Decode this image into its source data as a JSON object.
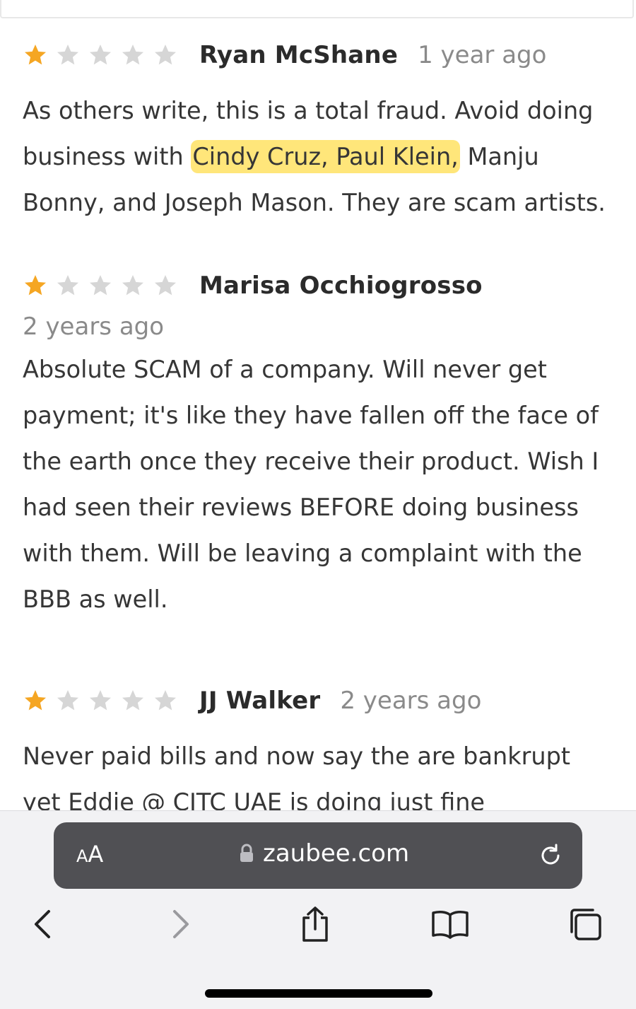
{
  "reviews": [
    {
      "author": "Ryan McShane",
      "time": "1 year ago",
      "rating": 1,
      "text_lines": [
        "As others write, this is a total fraud. Avoid doing",
        "business with ",
        "Bonny, and Joseph Mason. They are scam artists."
      ],
      "highlight": "Cindy Cruz, Paul Klein,",
      "after_highlight": " Manju"
    },
    {
      "author": "Marisa Occhiogrosso",
      "time": "2 years ago",
      "rating": 1,
      "text_lines": [
        "Absolute SCAM of a company. Will never get",
        "payment; it's like they have fallen off the face of",
        "the earth once they receive their product. Wish I",
        "had seen their reviews BEFORE doing business",
        "with them. Will be leaving a complaint with the",
        "BBB as well."
      ]
    },
    {
      "author": "JJ Walker",
      "time": "2 years ago",
      "rating": 1,
      "text_lines": [
        "Never paid bills and now say the are bankrupt",
        "yet Eddie @ CITC UAE is doing just fine"
      ]
    }
  ],
  "browser": {
    "reader_label_big": "A",
    "reader_label_small": "A",
    "url": "zaubee.com"
  },
  "colors": {
    "star_filled": "#f5a623",
    "star_empty": "#d6d6d6",
    "highlight": "#ffd628",
    "urlbar": "#505054"
  }
}
